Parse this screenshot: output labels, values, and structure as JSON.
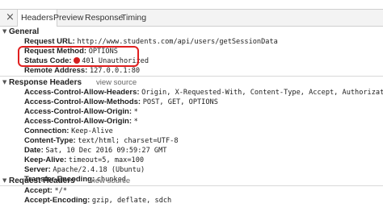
{
  "tabs": [
    {
      "label": "Headers",
      "active": true
    },
    {
      "label": "Preview"
    },
    {
      "label": "Response"
    },
    {
      "label": "Timing"
    }
  ],
  "general": {
    "title": "General",
    "rows": [
      {
        "key": "Request URL:",
        "value": "http://www.students.com/api/users/getSessionData"
      },
      {
        "key": "Request Method:",
        "value": "OPTIONS"
      },
      {
        "key": "Status Code:",
        "value": "401 Unauthorized"
      },
      {
        "key": "Remote Address:",
        "value": "127.0.0.1:80"
      }
    ]
  },
  "response_headers": {
    "title": "Response Headers",
    "view_source": "view source",
    "rows": [
      {
        "key": "Access-Control-Allow-Headers:",
        "value": "Origin, X-Requested-With, Content-Type, Accept, Authorization"
      },
      {
        "key": "Access-Control-Allow-Methods:",
        "value": "POST, GET, OPTIONS"
      },
      {
        "key": "Access-Control-Allow-Origin:",
        "value": "*"
      },
      {
        "key": "Access-Control-Allow-Origin:",
        "value": "*"
      },
      {
        "key": "Connection:",
        "value": "Keep-Alive"
      },
      {
        "key": "Content-Type:",
        "value": "text/html; charset=UTF-8"
      },
      {
        "key": "Date:",
        "value": "Sat, 10 Dec 2016 09:59:27 GMT"
      },
      {
        "key": "Keep-Alive:",
        "value": "timeout=5, max=100"
      },
      {
        "key": "Server:",
        "value": "Apache/2.4.18 (Ubuntu)"
      },
      {
        "key": "Transfer-Encoding:",
        "value": "chunked"
      }
    ]
  },
  "request_headers": {
    "title": "Request Headers",
    "view_source": "view source",
    "rows": [
      {
        "key": "Accept:",
        "value": "*/*"
      },
      {
        "key": "Accept-Encoding:",
        "value": "gzip, deflate, sdch"
      }
    ]
  },
  "colors": {
    "status_error": "#d32020",
    "highlight": "#e02020"
  }
}
